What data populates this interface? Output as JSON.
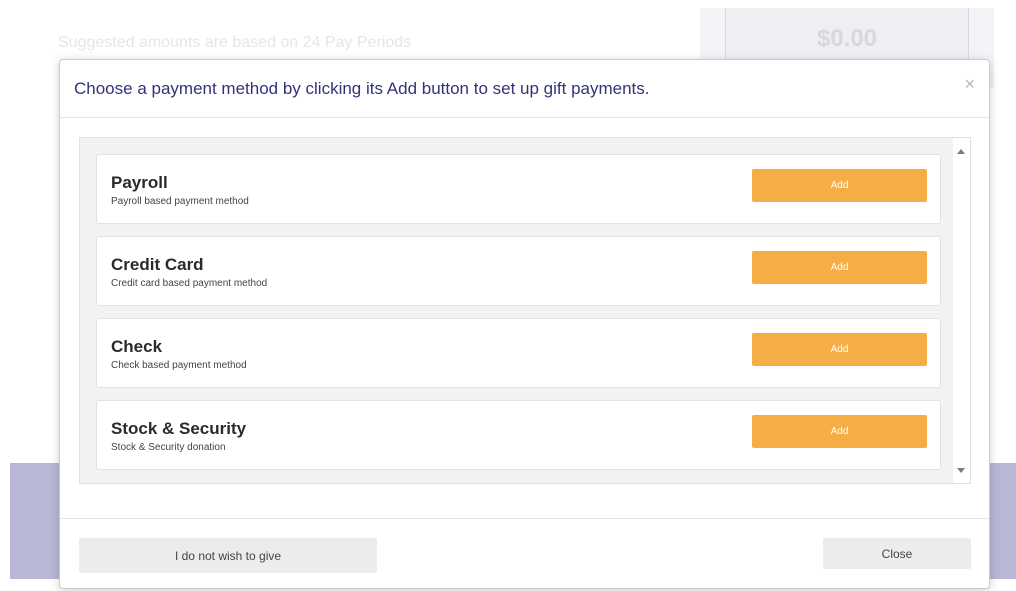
{
  "background": {
    "suggested_text": "Suggested amounts are based on 24 Pay Periods",
    "amount": "$0.00"
  },
  "modal": {
    "title": "Choose a payment method by clicking its Add button to set up gift payments.",
    "close_glyph": "×",
    "methods": [
      {
        "name": "Payroll",
        "description": "Payroll based payment method",
        "button": "Add"
      },
      {
        "name": "Credit Card",
        "description": "Credit card based payment method",
        "button": "Add"
      },
      {
        "name": "Check",
        "description": "Check based payment method",
        "button": "Add"
      },
      {
        "name": "Stock & Security",
        "description": "Stock & Security donation",
        "button": "Add"
      }
    ],
    "footer": {
      "decline_label": "I do not wish to give",
      "close_label": "Close"
    }
  },
  "colors": {
    "accent": "#f5ae45",
    "title": "#33337a",
    "band": "#b8b8d6"
  }
}
